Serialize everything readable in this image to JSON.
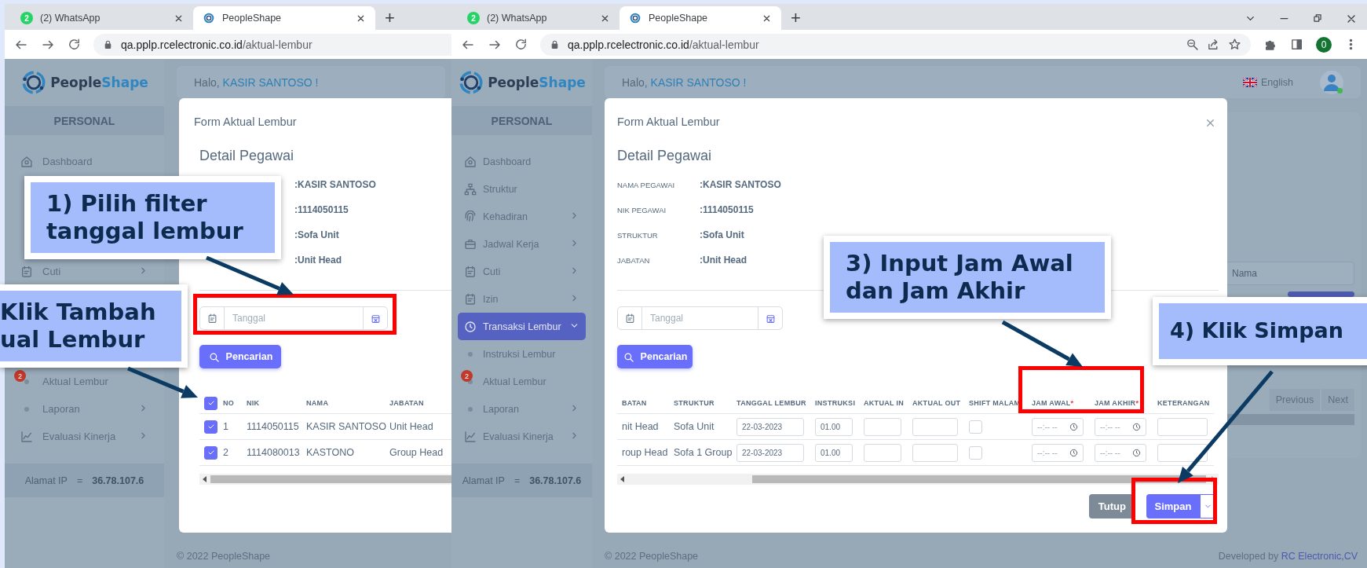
{
  "panels": [
    {
      "browser": {
        "tabs": [
          {
            "title": "(2) WhatsApp",
            "badge": "2",
            "selected": false
          },
          {
            "title": "PeopleShape",
            "selected": true
          }
        ],
        "new_tab": "+",
        "url_host": "qa.pplp.rcelectronic.co.id",
        "url_path": "/aktual-lembur"
      },
      "sidebar": {
        "logo": [
          "People",
          "Shape"
        ],
        "section": "PERSONAL",
        "items": [
          {
            "label": "Dashboard",
            "kind": "dashboard",
            "selected": false
          },
          {
            "label": "Cuti",
            "kind": "leave",
            "has_children": true,
            "selected": false
          },
          {
            "label": "Aktual Lembur",
            "kind": "sub",
            "badge": "2",
            "selected": false
          },
          {
            "label": "Laporan",
            "kind": "sub",
            "has_children": true,
            "selected": false
          },
          {
            "label": "Evaluasi Kinerja",
            "kind": "performance",
            "has_children": true,
            "selected": false
          }
        ],
        "ip_label": "Alamat IP",
        "ip_sep": "=",
        "ip_value": "36.78.107.6"
      },
      "header": {
        "greeting": "Halo,",
        "name": "KASIR SANTOSO !"
      },
      "modal": {
        "title": "Form Aktual Lembur",
        "heading": "Detail Pegawai",
        "details": [
          {
            "value": ":KASIR SANTOSO"
          },
          {
            "value": ":1114050115"
          },
          {
            "value": ":Sofa Unit"
          },
          {
            "value": ":Unit Head"
          }
        ],
        "filter": {
          "placeholder": "Tanggal"
        },
        "search_button": "Pencarian",
        "table": {
          "columns": [
            {
              "kind": "check",
              "checked": true
            },
            {
              "kind": "text",
              "label": "NO"
            },
            {
              "kind": "text",
              "label": "NIK"
            },
            {
              "kind": "text",
              "label": "NAMA"
            },
            {
              "kind": "text",
              "label": "JABATAN"
            }
          ],
          "rows": [
            {
              "cells": [
                {
                  "kind": "check",
                  "checked": true
                },
                {
                  "kind": "text",
                  "text": "1"
                },
                {
                  "kind": "text",
                  "text": "1114050115"
                },
                {
                  "kind": "text",
                  "text": "KASIR SANTOSO"
                },
                {
                  "kind": "text",
                  "text": "Unit Head"
                }
              ]
            },
            {
              "cells": [
                {
                  "kind": "check",
                  "checked": true
                },
                {
                  "kind": "text",
                  "text": "2"
                },
                {
                  "kind": "text",
                  "text": "1114080013"
                },
                {
                  "kind": "text",
                  "text": "KASTONO"
                },
                {
                  "kind": "text",
                  "text": "Group Head"
                }
              ]
            }
          ]
        }
      },
      "footer": {
        "copyright": "© 2022 PeopleShape"
      }
    },
    {
      "browser": {
        "tabs": [
          {
            "title": "(2) WhatsApp",
            "badge": "2",
            "selected": false
          },
          {
            "title": "PeopleShape",
            "selected": true
          }
        ],
        "new_tab": "+",
        "url_host": "qa.pplp.rcelectronic.co.id",
        "url_path": "/aktual-lembur",
        "profile": "0"
      },
      "sidebar": {
        "logo": [
          "People",
          "Shape"
        ],
        "section": "PERSONAL",
        "items": [
          {
            "label": "Dashboard",
            "kind": "dashboard",
            "selected": false
          },
          {
            "label": "Struktur",
            "kind": "structure",
            "selected": false
          },
          {
            "label": "Kehadiran",
            "kind": "attendance",
            "has_children": true,
            "selected": false
          },
          {
            "label": "Jadwal Kerja",
            "kind": "schedule",
            "has_children": true,
            "selected": false
          },
          {
            "label": "Cuti",
            "kind": "leave",
            "has_children": true,
            "selected": false
          },
          {
            "label": "Izin",
            "kind": "leave",
            "has_children": true,
            "selected": false
          },
          {
            "label": "Transaksi Lembur",
            "kind": "overtime",
            "has_children": true,
            "expanded": true,
            "selected": true
          },
          {
            "label": "Instruksi Lembur",
            "kind": "sub",
            "selected": false
          },
          {
            "label": "Aktual Lembur",
            "kind": "sub",
            "badge": "2",
            "selected": false
          },
          {
            "label": "Laporan",
            "kind": "sub",
            "has_children": true,
            "selected": false
          },
          {
            "label": "Evaluasi Kinerja",
            "kind": "performance",
            "has_children": true,
            "selected": false
          }
        ],
        "ip_label": "Alamat IP",
        "ip_sep": "=",
        "ip_value": "36.78.107.6"
      },
      "header": {
        "greeting": "Halo,",
        "name": "KASIR SANTOSO !",
        "language": "English"
      },
      "card": {
        "search_field": {
          "placeholder": "Nama"
        },
        "pager": [
          "Previous",
          "Next"
        ]
      },
      "modal": {
        "title": "Form Aktual Lembur",
        "closable": true,
        "heading": "Detail Pegawai",
        "details": [
          {
            "label": "NAMA PEGAWAI",
            "value": ":KASIR SANTOSO"
          },
          {
            "label": "NIK PEGAWAI",
            "value": ":1114050115"
          },
          {
            "label": "STRUKTUR",
            "value": ":Sofa Unit"
          },
          {
            "label": "JABATAN",
            "value": ":Unit Head"
          }
        ],
        "filter": {
          "placeholder": "Tanggal"
        },
        "search_button": "Pencarian",
        "table": {
          "columns": [
            {
              "kind": "text",
              "label": "BATAN"
            },
            {
              "kind": "text",
              "label": "STRUKTUR"
            },
            {
              "kind": "text",
              "label": "TANGGAL LEMBUR"
            },
            {
              "kind": "text",
              "label": "INSTRUKSI"
            },
            {
              "kind": "text",
              "label": "AKTUAL IN"
            },
            {
              "kind": "text",
              "label": "AKTUAL OUT"
            },
            {
              "kind": "text",
              "label": "SHIFT MALAM"
            },
            {
              "kind": "text",
              "label": "JAM AWAL",
              "required_mark": "*"
            },
            {
              "kind": "text",
              "label": "JAM AKHIR",
              "required_mark": "*"
            },
            {
              "kind": "text",
              "label": "KETERANGAN"
            }
          ],
          "rows": [
            {
              "cells": [
                {
                  "kind": "text",
                  "text": "nit Head"
                },
                {
                  "kind": "text",
                  "text": "Sofa Unit"
                },
                {
                  "kind": "input",
                  "value": "22-03-2023"
                },
                {
                  "kind": "input",
                  "value": "01.00"
                },
                {
                  "kind": "input"
                },
                {
                  "kind": "input"
                },
                {
                  "kind": "check",
                  "checked": false
                },
                {
                  "kind": "time",
                  "placeholder": "--:-- --"
                },
                {
                  "kind": "time",
                  "placeholder": "--:-- --"
                },
                {
                  "kind": "input"
                }
              ]
            },
            {
              "cells": [
                {
                  "kind": "text",
                  "text": "roup Head"
                },
                {
                  "kind": "text",
                  "text": "Sofa 1 Group"
                },
                {
                  "kind": "input",
                  "value": "22-03-2023"
                },
                {
                  "kind": "input",
                  "value": "01.00"
                },
                {
                  "kind": "input"
                },
                {
                  "kind": "input"
                },
                {
                  "kind": "check",
                  "checked": false
                },
                {
                  "kind": "time",
                  "placeholder": "--:-- --"
                },
                {
                  "kind": "time",
                  "placeholder": "--:-- --"
                },
                {
                  "kind": "input"
                }
              ]
            }
          ]
        },
        "buttons": [
          {
            "label": "Tutup",
            "kind": "secondary"
          },
          {
            "label": "Simpan",
            "kind": "split"
          }
        ]
      },
      "footer": {
        "copyright": "© 2022 PeopleShape",
        "developed_by": "Developed by",
        "developer": "RC Electronic,CV"
      }
    }
  ],
  "callouts": [
    {
      "lines": [
        "1) Pilih filter",
        "tanggal lembur"
      ]
    },
    {
      "lines": [
        "Klik Tambah",
        "ual Lembur"
      ]
    },
    {
      "lines": [
        "3) Input Jam Awal",
        "dan Jam Akhir"
      ]
    },
    {
      "lines": [
        "4) Klik Simpan"
      ]
    }
  ]
}
